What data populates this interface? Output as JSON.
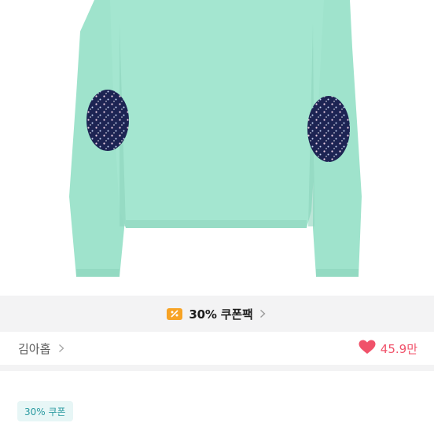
{
  "product": {
    "image_icon": "teal-long-sleeve-top-with-floral-elbow-patches",
    "shirt_color": "#9fe3cc",
    "patch_color": "#1d2453"
  },
  "coupon_bar": {
    "icon": "coupon-ticket-icon",
    "label": "30% 쿠폰팩",
    "chevron_icon": "chevron-right-icon"
  },
  "shop": {
    "name": "김아홉",
    "chevron_icon": "chevron-right-icon"
  },
  "likes": {
    "icon": "heart-icon",
    "count": "45.9만",
    "color": "#f0526a"
  },
  "badges": {
    "coupon": "30% 쿠폰"
  }
}
